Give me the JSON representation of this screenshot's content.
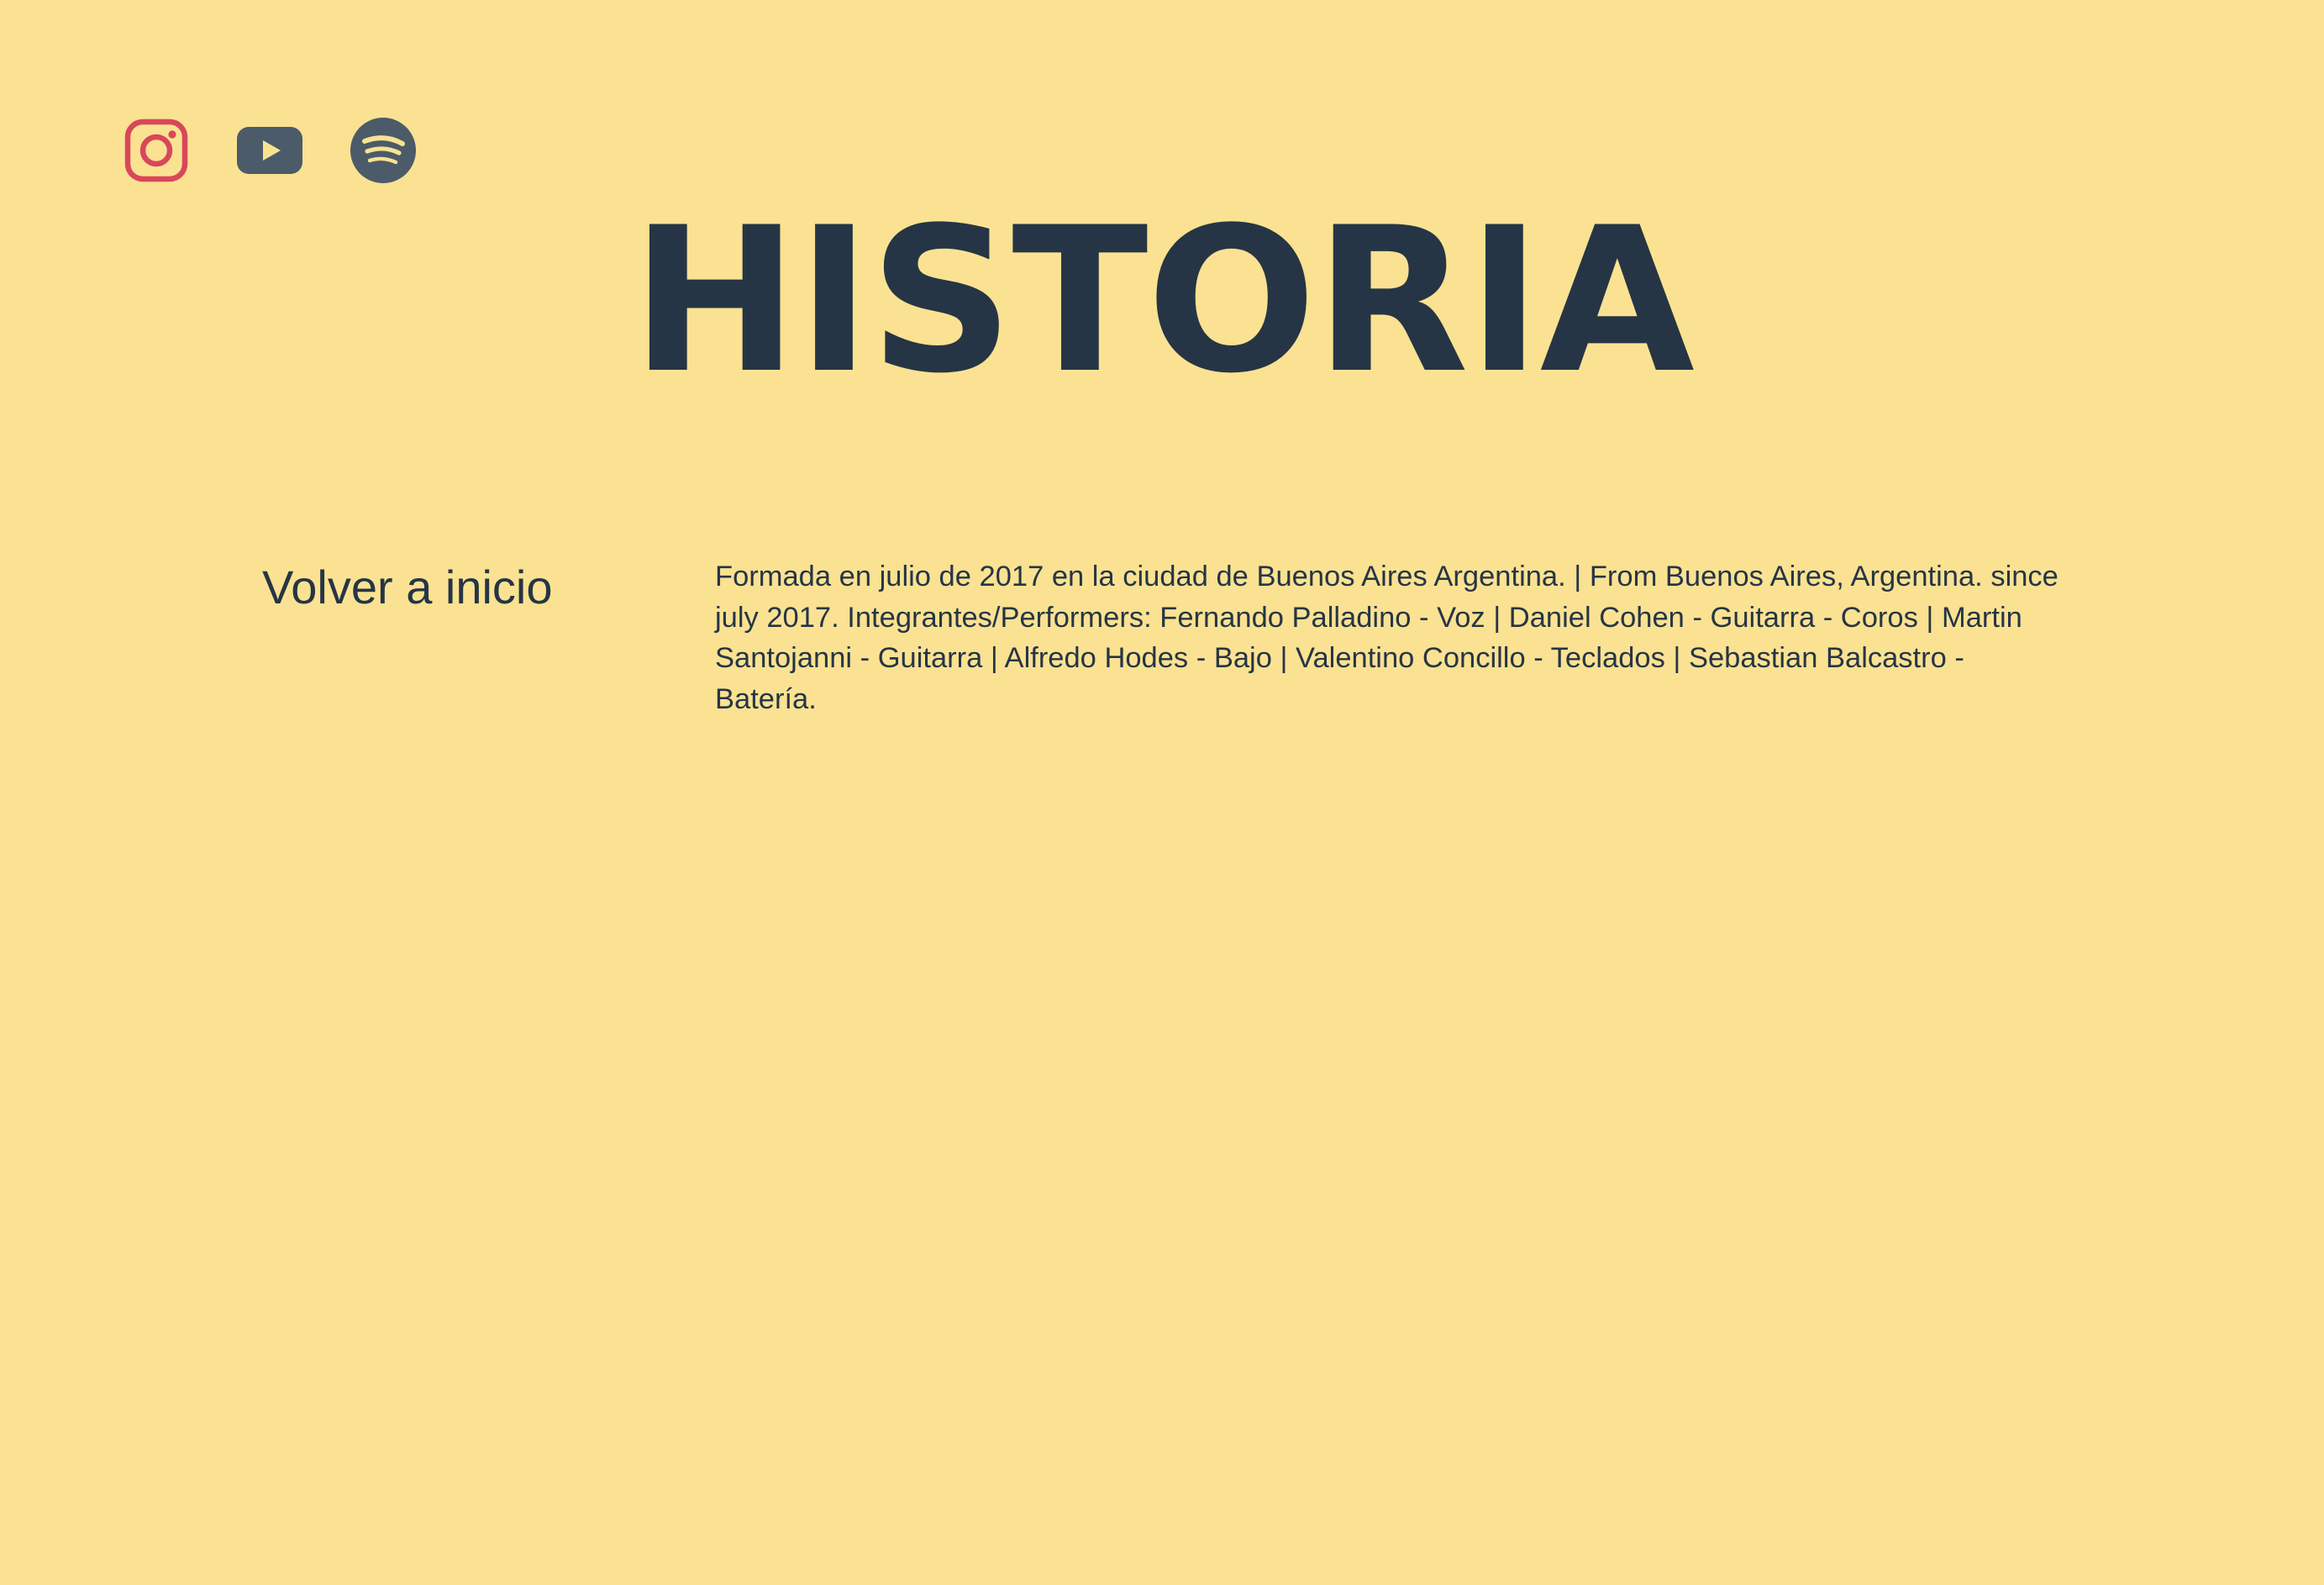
{
  "theme": {
    "background": "#FAE292",
    "text": "#263545",
    "instagram_icon": "#D9475A",
    "youtube_icon": "#4C5B69",
    "spotify_icon": "#4C5B69",
    "spotify_waves": "#FAE292"
  },
  "social": {
    "icons": [
      "instagram-icon",
      "youtube-icon",
      "spotify-icon"
    ]
  },
  "header": {
    "title": "HISTORIA"
  },
  "nav": {
    "back_label": "Volver a inicio"
  },
  "content": {
    "history": "Formada en julio de 2017 en la ciudad de Buenos Aires Argentina. | From Buenos Aires, Argentina. since july 2017. Integrantes/Performers: Fernando Palladino - Voz | Daniel Cohen - Guitarra - Coros | Martin Santojanni - Guitarra | Alfredo Hodes - Bajo | Valentino Concillo - Teclados | Sebastian Balcastro - Batería."
  }
}
